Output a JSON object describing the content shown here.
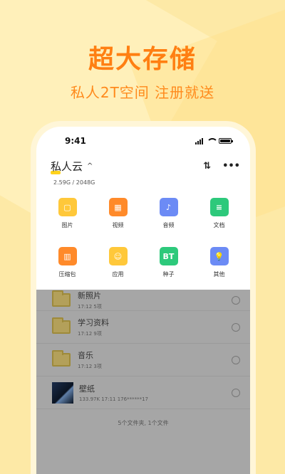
{
  "headline": "超大存储",
  "subline": "私人2T空间  注册就送",
  "status_bar": {
    "time": "9:41"
  },
  "app": {
    "title": "私人云",
    "caret": "^",
    "sort_label": "⇅",
    "more_label": "•••",
    "storage": "2.59G / 2048G"
  },
  "categories": [
    {
      "label": "图片",
      "color": "#FFC83A",
      "icon": "image-icon",
      "glyph": "▢"
    },
    {
      "label": "视频",
      "color": "#FF8A2A",
      "icon": "video-icon",
      "glyph": "▦"
    },
    {
      "label": "音频",
      "color": "#6C8BF5",
      "icon": "audio-icon",
      "glyph": "♪"
    },
    {
      "label": "文档",
      "color": "#2DC97B",
      "icon": "document-icon",
      "glyph": "≡"
    },
    {
      "label": "压缩包",
      "color": "#FF8A2A",
      "icon": "archive-icon",
      "glyph": "▥"
    },
    {
      "label": "应用",
      "color": "#FFC83A",
      "icon": "app-icon",
      "glyph": "☺"
    },
    {
      "label": "种子",
      "color": "#2DC97B",
      "icon": "torrent-icon",
      "glyph": "BT"
    },
    {
      "label": "其他",
      "color": "#6C8BF5",
      "icon": "other-icon",
      "glyph": "💡"
    }
  ],
  "files": [
    {
      "name": "新照片",
      "meta": "17:12  5项",
      "type": "folder"
    },
    {
      "name": "学习资料",
      "meta": "17:12  9项",
      "type": "folder"
    },
    {
      "name": "音乐",
      "meta": "17:12  3项",
      "type": "folder"
    },
    {
      "name": "壁纸",
      "meta": "133.97K   17:11   176******17",
      "type": "image"
    }
  ],
  "footer": "5个文件夹, 1个文件"
}
